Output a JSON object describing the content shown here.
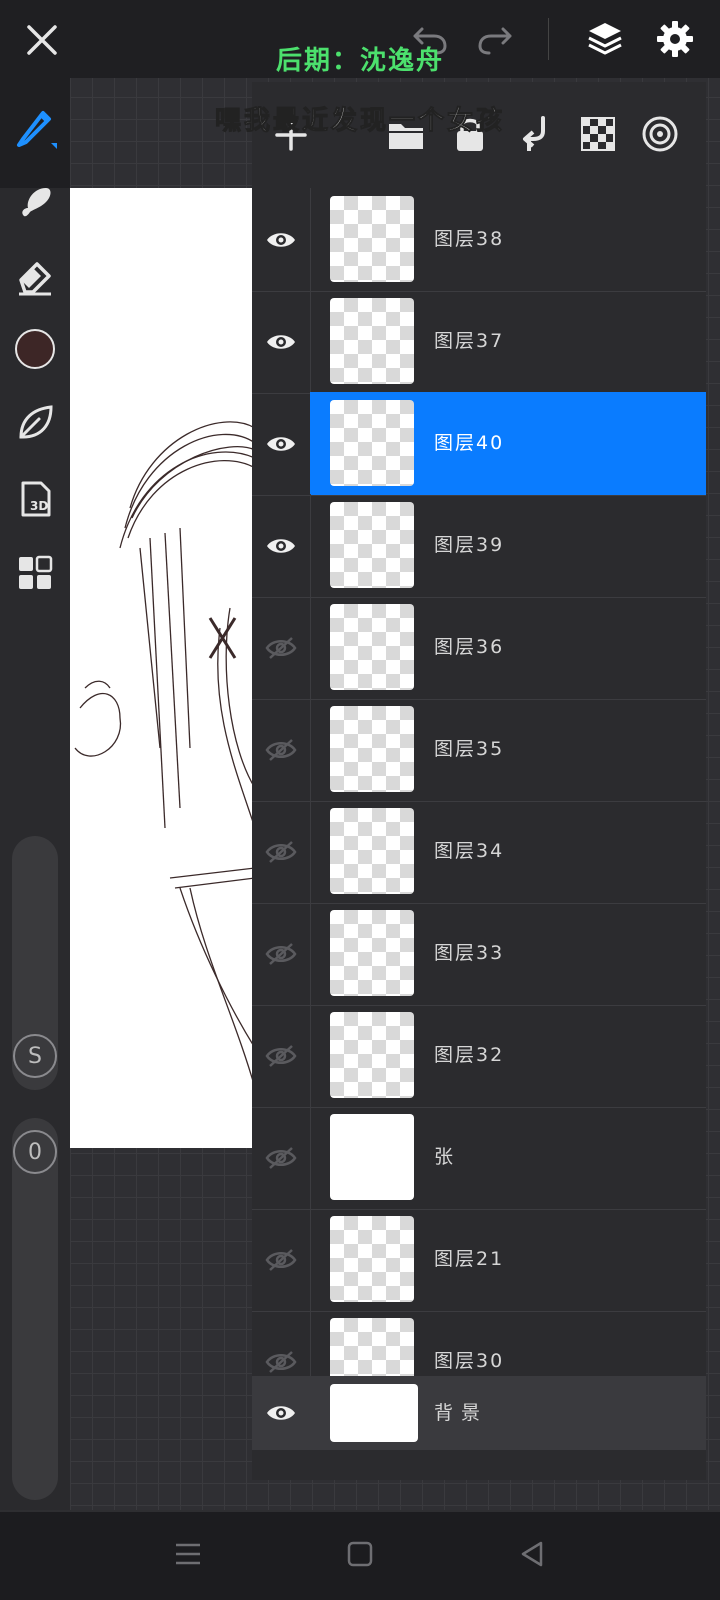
{
  "captions": {
    "top": "后期：沈逸舟",
    "subtitle": "嘿我最近发现一个女孩"
  },
  "toolbar": {
    "close": "close-icon",
    "undo": "undo-icon",
    "redo": "redo-icon",
    "layers": "layers-icon",
    "settings": "gear-icon"
  },
  "layer_toolbar": [
    "add-icon",
    "folder-icon",
    "lock-icon",
    "merge-down-icon",
    "transparency-icon",
    "blend-icon"
  ],
  "tools": [
    "pen-icon",
    "smudge-icon",
    "eraser-icon",
    "color-swatch",
    "leaf-icon",
    "3d-icon",
    "grid-icon"
  ],
  "color": "#3d2626",
  "accent": "#0a7cff",
  "sliders": {
    "size_label": "S",
    "opacity_label": "0"
  },
  "layers": [
    {
      "name": "图层38",
      "visible": true,
      "active": false
    },
    {
      "name": "图层37",
      "visible": true,
      "active": false
    },
    {
      "name": "图层40",
      "visible": true,
      "active": true
    },
    {
      "name": "图层39",
      "visible": true,
      "active": false
    },
    {
      "name": "图层36",
      "visible": false,
      "active": false
    },
    {
      "name": "图层35",
      "visible": false,
      "active": false
    },
    {
      "name": "图层34",
      "visible": false,
      "active": false
    },
    {
      "name": "图层33",
      "visible": false,
      "active": false
    },
    {
      "name": "图层32",
      "visible": false,
      "active": false
    },
    {
      "name": "张",
      "visible": false,
      "active": false
    },
    {
      "name": "图层21",
      "visible": false,
      "active": false
    },
    {
      "name": "图层30",
      "visible": false,
      "active": false
    },
    {
      "name": "背景",
      "visible": true,
      "active": false
    }
  ],
  "nav": [
    "menu-icon",
    "home-icon",
    "back-icon"
  ]
}
